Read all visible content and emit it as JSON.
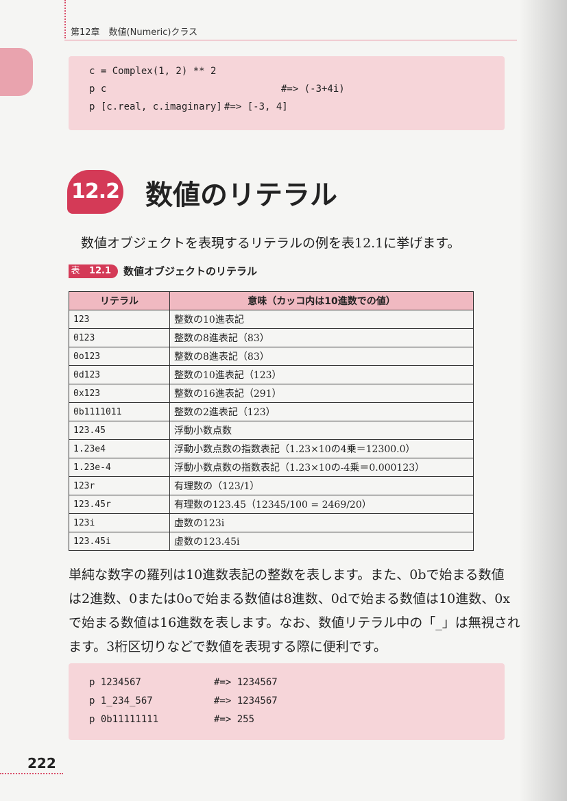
{
  "header": {
    "chapter": "第12章　数値(Numeric)クラス"
  },
  "code_top": {
    "lines": [
      {
        "code": "c = Complex(1, 2) ** 2",
        "result": ""
      },
      {
        "code": "p c",
        "result": "#=> (-3+4i)"
      },
      {
        "code": "p [c.real, c.imaginary]",
        "result": "#=> [-3, 4]"
      }
    ]
  },
  "section": {
    "number": "12.2",
    "title": "数値のリテラル"
  },
  "intro": "数値オブジェクトを表現するリテラルの例を表12.1に挙げます。",
  "table": {
    "caption_prefix": "表",
    "caption_number": "12.1",
    "caption_title": "数値オブジェクトのリテラル",
    "headers": [
      "リテラル",
      "意味（カッコ内は10進数での値）"
    ],
    "rows": [
      [
        "123",
        "整数の10進表記"
      ],
      [
        "0123",
        "整数の8進表記（83）"
      ],
      [
        "0o123",
        "整数の8進表記（83）"
      ],
      [
        "0d123",
        "整数の10進表記（123）"
      ],
      [
        "0x123",
        "整数の16進表記（291）"
      ],
      [
        "0b1111011",
        "整数の2進表記（123）"
      ],
      [
        "123.45",
        "浮動小数点数"
      ],
      [
        "1.23e4",
        "浮動小数点数の指数表記（1.23×10の4乗＝12300.0）"
      ],
      [
        "1.23e-4",
        "浮動小数点数の指数表記（1.23×10の-4乗＝0.000123）"
      ],
      [
        "123r",
        "有理数の（123/1）"
      ],
      [
        "123.45r",
        "有理数の123.45（12345/100 = 2469/20）"
      ],
      [
        "123i",
        "虚数の123i"
      ],
      [
        "123.45i",
        "虚数の123.45i"
      ]
    ]
  },
  "body": {
    "lines": [
      "単純な数字の羅列は10進数表記の整数を表します。また、0bで始まる数値",
      "は2進数、0または0oで始まる数値は8進数、0dで始まる数値は10進数、0x",
      "で始まる数値は16進数を表します。なお、数値リテラル中の「_」は無視され",
      "ます。3桁区切りなどで数値を表現する際に便利です。"
    ]
  },
  "code_bottom": {
    "lines": [
      {
        "code": "p 1234567",
        "result": "#=> 1234567"
      },
      {
        "code": "p 1_234_567",
        "result": "#=> 1234567"
      },
      {
        "code": "p 0b11111111",
        "result": "#=> 255"
      }
    ]
  },
  "page_number": "222"
}
